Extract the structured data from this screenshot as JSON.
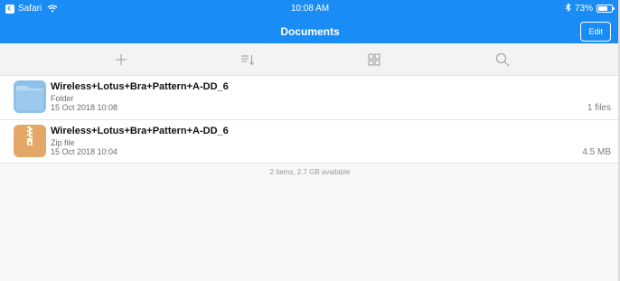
{
  "status_bar": {
    "back_app": "Safari",
    "time": "10:08 AM",
    "battery_text": "73%",
    "battery_level": 0.73,
    "bluetooth_icon": "bluetooth-icon",
    "wifi_icon": "wifi-icon"
  },
  "nav": {
    "title": "Documents",
    "edit_label": "Edit",
    "accent_color": "#1a8cf6"
  },
  "toolbar": {
    "items": [
      {
        "icon": "plus-icon"
      },
      {
        "icon": "sort-icon"
      },
      {
        "icon": "grid-view-icon"
      },
      {
        "icon": "search-icon"
      }
    ]
  },
  "files": [
    {
      "name": "Wireless+Lotus+Bra+Pattern+A-DD_6",
      "kind": "Folder",
      "date": "15 Oct 2018 10:08",
      "meta": "1 files",
      "icon": "folder-icon",
      "icon_color": "#8ec1ea"
    },
    {
      "name": "Wireless+Lotus+Bra+Pattern+A-DD_6",
      "kind": "Zip file",
      "date": "15 Oct 2018 10:04",
      "meta": "4.5 MB",
      "icon": "zip-file-icon",
      "icon_color": "#e3a867"
    }
  ],
  "footer": {
    "summary": "2 items, 2.7 GB available"
  }
}
